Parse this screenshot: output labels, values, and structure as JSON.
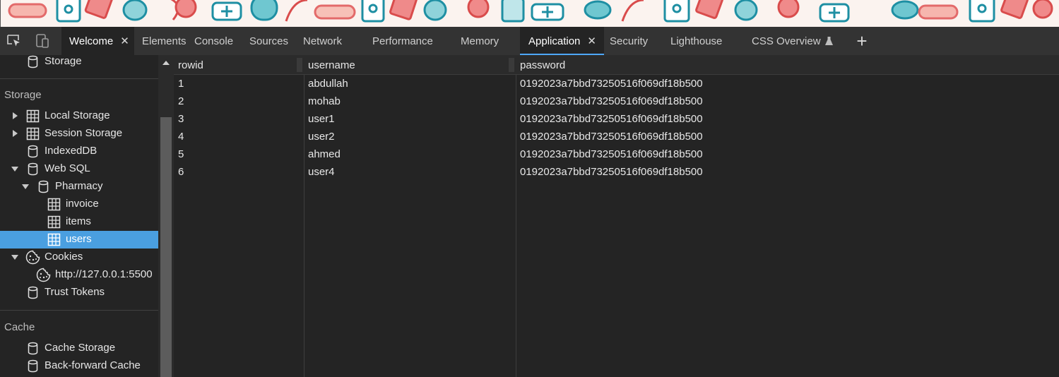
{
  "tabs": [
    {
      "label": "Welcome",
      "closable": true,
      "state": "open"
    },
    {
      "label": "Elements"
    },
    {
      "label": "Console"
    },
    {
      "label": "Sources"
    },
    {
      "label": "Network"
    },
    {
      "label": "Performance"
    },
    {
      "label": "Memory"
    },
    {
      "label": "Application",
      "closable": true,
      "state": "active"
    },
    {
      "label": "Security"
    },
    {
      "label": "Lighthouse"
    },
    {
      "label": "CSS Overview",
      "experimental_icon": "flask-icon"
    }
  ],
  "close_glyph": "✕",
  "plus_glyph": "+",
  "sidebar": {
    "top_item": {
      "label": "Storage",
      "icon": "database-icon"
    },
    "sections": {
      "storage": "Storage",
      "cache": "Cache"
    },
    "items": [
      {
        "label": "Local Storage",
        "icon": "grid-icon",
        "expander": "collapsed"
      },
      {
        "label": "Session Storage",
        "icon": "grid-icon",
        "expander": "collapsed"
      },
      {
        "label": "IndexedDB",
        "icon": "database-icon"
      },
      {
        "label": "Web SQL",
        "icon": "database-icon",
        "expander": "expanded"
      },
      {
        "label": "Pharmacy",
        "icon": "database-icon",
        "expander": "expanded"
      },
      {
        "label": "invoice",
        "icon": "grid-icon"
      },
      {
        "label": "items",
        "icon": "grid-icon"
      },
      {
        "label": "users",
        "icon": "grid-icon",
        "selected": true
      },
      {
        "label": "Cookies",
        "icon": "cookie-icon",
        "expander": "expanded"
      },
      {
        "label": "http://127.0.0.1:5500",
        "icon": "cookie-icon"
      },
      {
        "label": "Trust Tokens",
        "icon": "database-icon"
      }
    ],
    "cache_items": [
      {
        "label": "Cache Storage",
        "icon": "database-icon"
      },
      {
        "label": "Back-forward Cache",
        "icon": "database-icon"
      }
    ]
  },
  "table": {
    "columns": [
      "rowid",
      "username",
      "password"
    ],
    "rows": [
      [
        "1",
        "abdullah",
        "0192023a7bbd73250516f069df18b500"
      ],
      [
        "2",
        "mohab",
        "0192023a7bbd73250516f069df18b500"
      ],
      [
        "3",
        "user1",
        "0192023a7bbd73250516f069df18b500"
      ],
      [
        "4",
        "user2",
        "0192023a7bbd73250516f069df18b500"
      ],
      [
        "5",
        "ahmed",
        "0192023a7bbd73250516f069df18b500"
      ],
      [
        "6",
        "user4",
        "0192023a7bbd73250516f069df18b500"
      ]
    ]
  },
  "colors": {
    "accent": "#4ea7ff",
    "selected_row": "#4a9fe0",
    "panel_bg": "#242424",
    "tabbar_bg": "#333333"
  }
}
